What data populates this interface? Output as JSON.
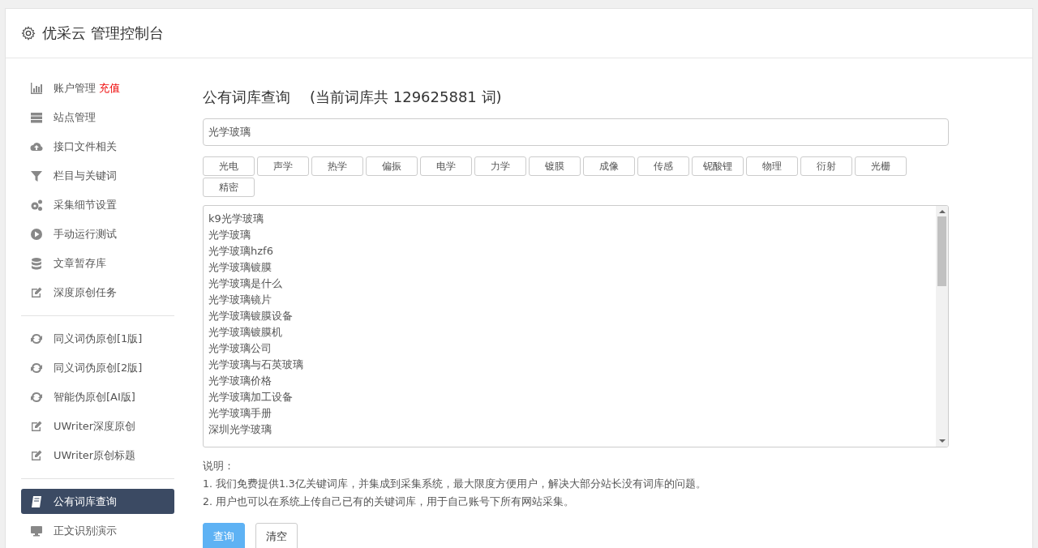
{
  "header": {
    "title": "优采云 管理控制台"
  },
  "sidebar": {
    "groups": [
      [
        {
          "label": "账户管理",
          "badge": "充值",
          "selected": false
        },
        {
          "label": "站点管理",
          "selected": false
        },
        {
          "label": "接口文件相关",
          "selected": false
        },
        {
          "label": "栏目与关键词",
          "selected": false
        },
        {
          "label": "采集细节设置",
          "selected": false
        },
        {
          "label": "手动运行测试",
          "selected": false
        },
        {
          "label": "文章暂存库",
          "selected": false
        },
        {
          "label": "深度原创任务",
          "selected": false
        }
      ],
      [
        {
          "label": "同义词伪原创[1版]",
          "selected": false
        },
        {
          "label": "同义词伪原创[2版]",
          "selected": false
        },
        {
          "label": "智能伪原创[AI版]",
          "selected": false
        },
        {
          "label": "UWriter深度原创",
          "selected": false
        },
        {
          "label": "UWriter原创标题",
          "selected": false
        }
      ],
      [
        {
          "label": "公有词库查询",
          "selected": true
        },
        {
          "label": "正文识别演示",
          "selected": false
        }
      ]
    ]
  },
  "main": {
    "title": "公有词库查询",
    "subtitle": "(当前词库共 129625881 词)",
    "search": {
      "value": "光学玻璃"
    },
    "tags": [
      "光电",
      "声学",
      "热学",
      "偏振",
      "电学",
      "力学",
      "镀膜",
      "成像",
      "传感",
      "铌酸锂",
      "物理",
      "衍射",
      "光栅",
      "精密"
    ],
    "results": [
      "k9光学玻璃",
      "光学玻璃",
      "光学玻璃hzf6",
      "光学玻璃镀膜",
      "光学玻璃是什么",
      "光学玻璃镜片",
      "光学玻璃镀膜设备",
      "光学玻璃镀膜机",
      "光学玻璃公司",
      "光学玻璃与石英玻璃",
      "光学玻璃价格",
      "光学玻璃加工设备",
      "光学玻璃手册",
      "深圳光学玻璃"
    ],
    "notes_title": "说明：",
    "notes": [
      "1. 我们免费提供1.3亿关键词库，并集成到采集系统，最大限度方便用户，解决大部分站长没有词库的问题。",
      "2. 用户也可以在系统上传自己已有的关键词库，用于自己账号下所有网站采集。"
    ],
    "buttons": [
      {
        "label": "查询",
        "kind": "primary"
      },
      {
        "label": "清空",
        "kind": "default"
      }
    ]
  }
}
